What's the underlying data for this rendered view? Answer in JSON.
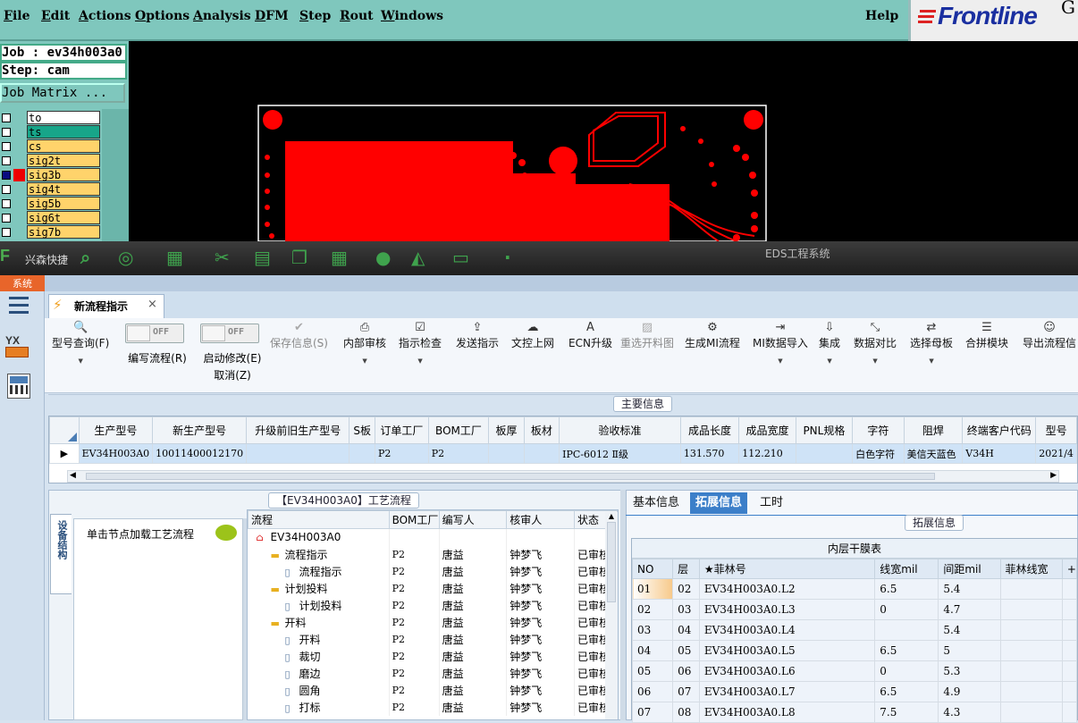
{
  "frontline": {
    "menu": [
      "File",
      "Edit",
      "Actions",
      "Options",
      "Analysis",
      "DFM",
      "Step",
      "Rout",
      "Windows"
    ],
    "help": "Help",
    "logo": "Frontline",
    "logo_tail": "G",
    "job": "Job : ev34h003a0",
    "step": "Step: cam",
    "job_matrix": "Job Matrix ...",
    "layers": [
      {
        "name": "to",
        "color": "#ffffff",
        "active": false
      },
      {
        "name": "ts",
        "color": "#17a589",
        "active": false
      },
      {
        "name": "cs",
        "color": "#ffd36b",
        "active": false
      },
      {
        "name": "sig2t",
        "color": "#ffd36b",
        "active": false
      },
      {
        "name": "sig3b",
        "color": "#ffd36b",
        "active": true
      },
      {
        "name": "sig4t",
        "color": "#ffd36b",
        "active": false
      },
      {
        "name": "sig5b",
        "color": "#ffd36b",
        "active": false
      },
      {
        "name": "sig6t",
        "color": "#ffd36b",
        "active": false
      },
      {
        "name": "sig7b",
        "color": "#ffd36b",
        "active": false
      }
    ]
  },
  "eds": {
    "window_title": "EDS工程系统",
    "shortcut_label": "兴森快捷",
    "system_tab": "系统",
    "tab": "新流程指示",
    "ribbon": [
      {
        "icon": "search-icon",
        "label": "型号查询(F)",
        "dropdown": true,
        "disabled": false
      },
      {
        "icon": "toggle",
        "label": "编写流程(R)",
        "toggle": "OFF"
      },
      {
        "icon": "toggle",
        "label": "启动修改(E)",
        "label2": "取消(Z)",
        "toggle": "OFF"
      },
      {
        "icon": "check-icon",
        "label": "保存信息(S)",
        "disabled": true
      },
      {
        "icon": "print-icon",
        "label": "内部审核",
        "dropdown": true
      },
      {
        "icon": "checkbox-icon",
        "label": "指示检查",
        "dropdown": true
      },
      {
        "icon": "upload-icon",
        "label": "发送指示"
      },
      {
        "icon": "cloud-upload-icon",
        "label": "文控上网"
      },
      {
        "icon": "ecn-icon",
        "label": "ECN升级"
      },
      {
        "icon": "image-icon",
        "label": "重选开料图",
        "disabled": true
      },
      {
        "icon": "gears-icon",
        "label": "生成MI流程"
      },
      {
        "icon": "import-icon",
        "label": "MI数据导入",
        "dropdown": true
      },
      {
        "icon": "download-icon",
        "label": "集成",
        "dropdown": true
      },
      {
        "icon": "compare-icon",
        "label": "数据对比",
        "dropdown": true
      },
      {
        "icon": "shuffle-icon",
        "label": "选择母板",
        "dropdown": true
      },
      {
        "icon": "list-icon",
        "label": "合拼模块"
      },
      {
        "icon": "smile-icon",
        "label": "导出流程信"
      }
    ],
    "main_info_label": "主要信息",
    "main_columns": [
      "生产型号",
      "新生产型号",
      "升级前旧生产型号",
      "S板",
      "订单工厂",
      "BOM工厂",
      "板厚",
      "板材",
      "验收标准",
      "成品长度",
      "成品宽度",
      "PNL规格",
      "字符",
      "阻焊",
      "终端客户代码",
      "型号"
    ],
    "main_row": [
      "EV34H003A0",
      "10011400012170",
      "",
      "",
      "P2",
      "P2",
      "",
      "",
      "IPC-6012 Ⅱ级",
      "131.570",
      "112.210",
      "",
      "白色字符",
      "美信天蓝色",
      "V34H",
      "2021/4"
    ],
    "process_label": "【EV34H003A0】工艺流程",
    "side_tab": "设备结构",
    "hint": "单击节点加载工艺流程",
    "tree_columns": [
      "流程",
      "BOM工厂",
      "编写人",
      "核审人",
      "状态"
    ],
    "tree_rows": [
      {
        "level": 0,
        "name": "EV34H003A0",
        "kind": "root",
        "bom": "",
        "writer": "",
        "reviewer": "",
        "status": ""
      },
      {
        "level": 1,
        "name": "流程指示",
        "kind": "folder",
        "bom": "P2",
        "writer": "唐益",
        "reviewer": "钟梦飞",
        "status": "已审核"
      },
      {
        "level": 2,
        "name": "流程指示",
        "kind": "doc",
        "bom": "P2",
        "writer": "唐益",
        "reviewer": "钟梦飞",
        "status": "已审核"
      },
      {
        "level": 1,
        "name": "计划投料",
        "kind": "folder",
        "bom": "P2",
        "writer": "唐益",
        "reviewer": "钟梦飞",
        "status": "已审核"
      },
      {
        "level": 2,
        "name": "计划投料",
        "kind": "doc",
        "bom": "P2",
        "writer": "唐益",
        "reviewer": "钟梦飞",
        "status": "已审核"
      },
      {
        "level": 1,
        "name": "开料",
        "kind": "folder",
        "bom": "P2",
        "writer": "唐益",
        "reviewer": "钟梦飞",
        "status": "已审核"
      },
      {
        "level": 2,
        "name": "开料",
        "kind": "doc",
        "bom": "P2",
        "writer": "唐益",
        "reviewer": "钟梦飞",
        "status": "已审核"
      },
      {
        "level": 2,
        "name": "裁切",
        "kind": "doc",
        "bom": "P2",
        "writer": "唐益",
        "reviewer": "钟梦飞",
        "status": "已审核"
      },
      {
        "level": 2,
        "name": "磨边",
        "kind": "doc",
        "bom": "P2",
        "writer": "唐益",
        "reviewer": "钟梦飞",
        "status": "已审核"
      },
      {
        "level": 2,
        "name": "圆角",
        "kind": "doc",
        "bom": "P2",
        "writer": "唐益",
        "reviewer": "钟梦飞",
        "status": "已审核"
      },
      {
        "level": 2,
        "name": "打标",
        "kind": "doc",
        "bom": "P2",
        "writer": "唐益",
        "reviewer": "钟梦飞",
        "status": "已审核"
      }
    ],
    "right_tabs": [
      "基本信息",
      "拓展信息",
      "工时"
    ],
    "ext_label": "拓展信息",
    "film_title": "内层干膜表",
    "film_columns": [
      "NO",
      "层",
      "★菲林号",
      "线宽mil",
      "间距mil",
      "菲林线宽",
      "+"
    ],
    "film_rows": [
      [
        "01",
        "02",
        "EV34H003A0.L2",
        "6.5",
        "5.4"
      ],
      [
        "02",
        "03",
        "EV34H003A0.L3",
        "0",
        "4.7"
      ],
      [
        "03",
        "04",
        "EV34H003A0.L4",
        "",
        "5.4"
      ],
      [
        "04",
        "05",
        "EV34H003A0.L5",
        "6.5",
        "5"
      ],
      [
        "05",
        "06",
        "EV34H003A0.L6",
        "0",
        "5.3"
      ],
      [
        "06",
        "07",
        "EV34H003A0.L7",
        "6.5",
        "4.9"
      ],
      [
        "07",
        "08",
        "EV34H003A0.L8",
        "7.5",
        "4.3"
      ]
    ],
    "colors": {
      "accent": "#3c7fc9",
      "orange": "#e8652a",
      "pcb_red": "#ff0000",
      "frontline_bg": "#7fc7bd"
    }
  }
}
